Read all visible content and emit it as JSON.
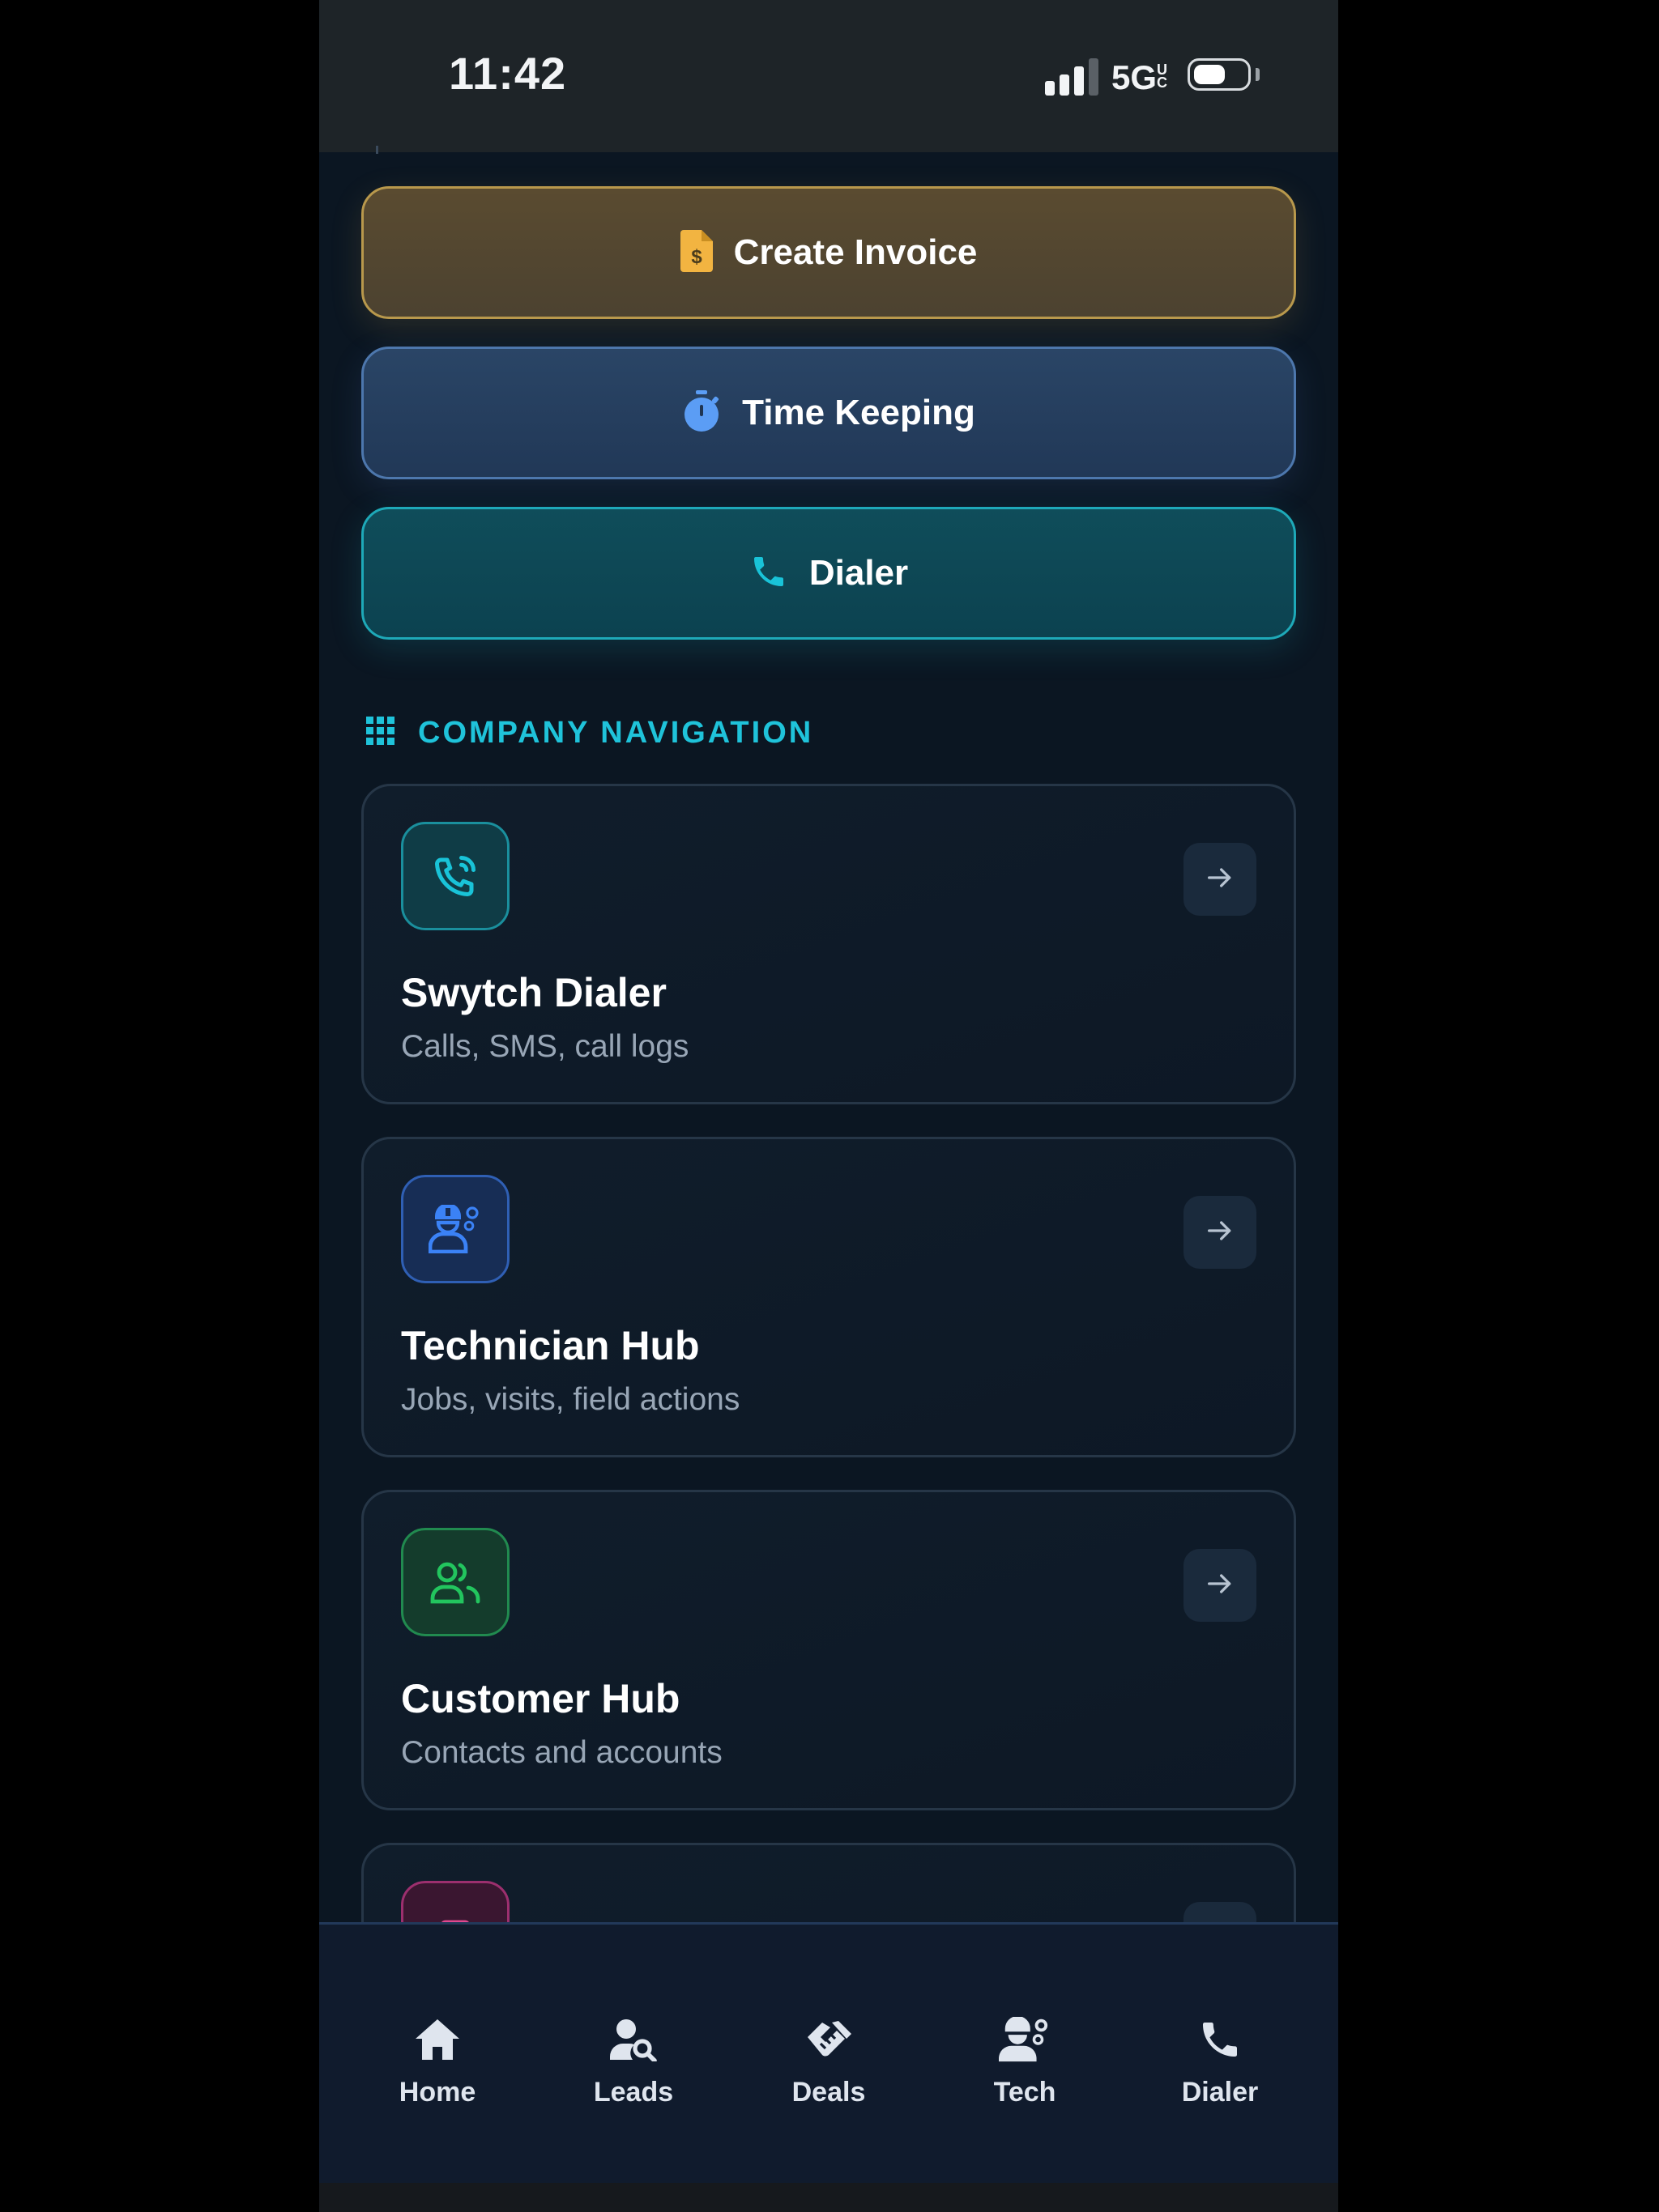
{
  "status_bar": {
    "time": "11:42",
    "network": "5G",
    "network_suffix": "UC"
  },
  "quick_actions": {
    "create_invoice": "Create Invoice",
    "time_keeping": "Time Keeping",
    "dialer": "Dialer"
  },
  "company_navigation": {
    "title": "COMPANY NAVIGATION",
    "cards": [
      {
        "title": "Swytch Dialer",
        "subtitle": "Calls, SMS, call logs",
        "icon": "phone-call-icon",
        "accent": "#19b6c9"
      },
      {
        "title": "Technician Hub",
        "subtitle": "Jobs, visits, field actions",
        "icon": "technician-icon",
        "accent": "#3b82f6"
      },
      {
        "title": "Customer Hub",
        "subtitle": "Contacts and accounts",
        "icon": "users-icon",
        "accent": "#22c55e"
      }
    ]
  },
  "tab_bar": {
    "items": [
      {
        "label": "Home",
        "icon": "home-icon"
      },
      {
        "label": "Leads",
        "icon": "user-search-icon"
      },
      {
        "label": "Deals",
        "icon": "handshake-icon"
      },
      {
        "label": "Tech",
        "icon": "technician-icon"
      },
      {
        "label": "Dialer",
        "icon": "phone-icon"
      }
    ]
  },
  "colors": {
    "background": "#0b1622",
    "invoice_accent": "#f2b441",
    "timekeeping_accent": "#5b9df5",
    "dialer_accent": "#19c3d8",
    "section_title": "#1fc3da"
  }
}
